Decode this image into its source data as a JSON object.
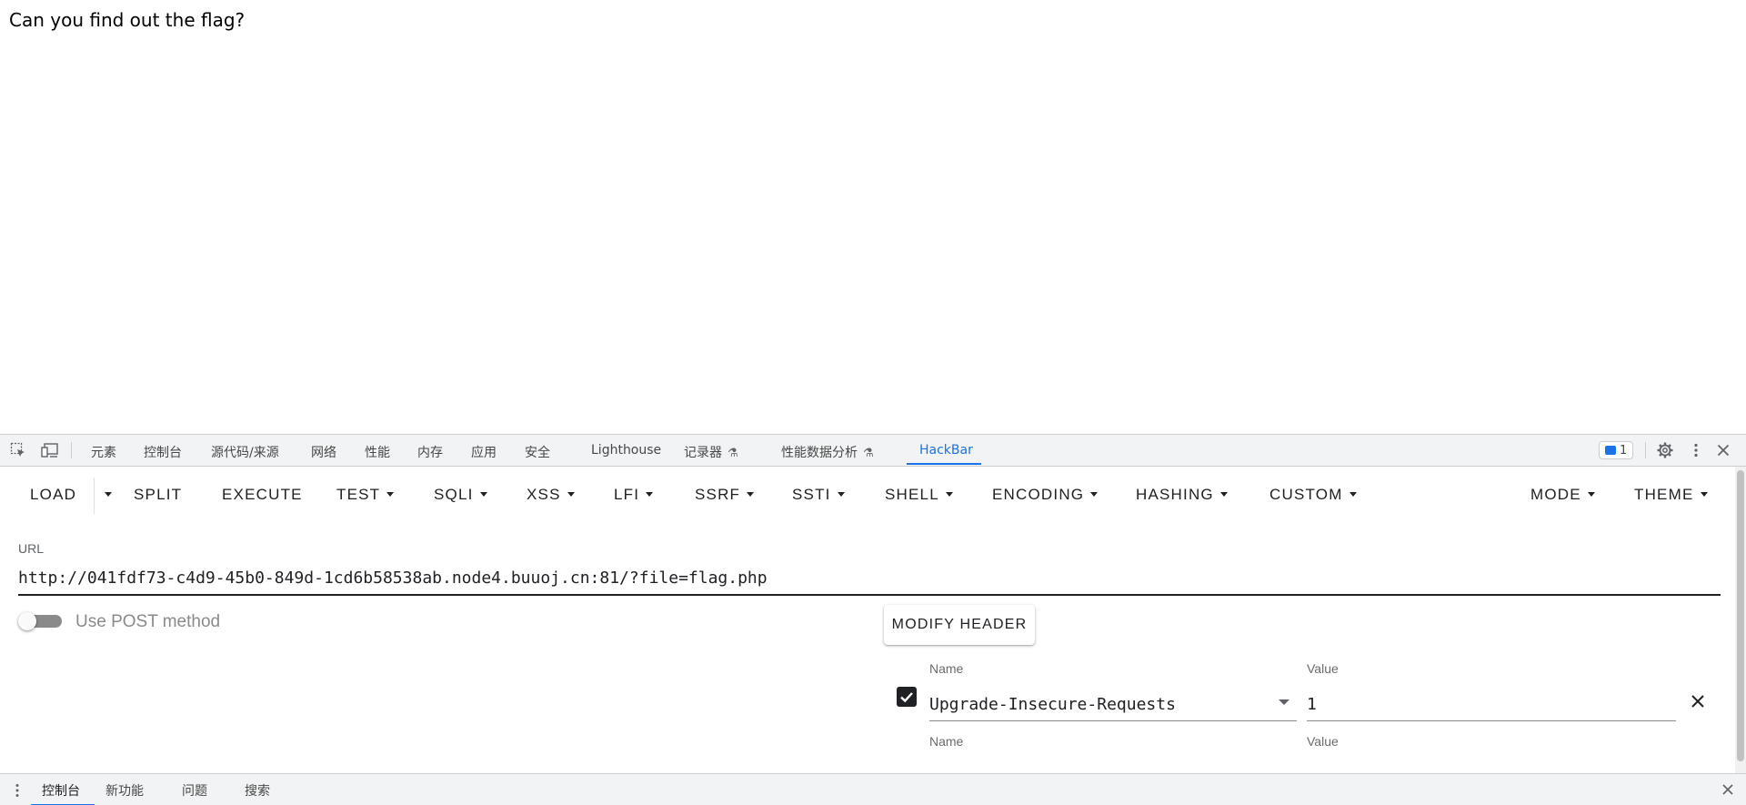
{
  "page": {
    "heading": "Can you find out the flag?"
  },
  "devtools": {
    "tabs": [
      "元素",
      "控制台",
      "源代码/来源",
      "网络",
      "性能",
      "内存",
      "应用",
      "安全",
      "Lighthouse",
      "记录器",
      "性能数据分析",
      "HackBar"
    ],
    "active_tab": "HackBar",
    "issues_count": "1",
    "accent_color": "#1a73e8"
  },
  "hackbar": {
    "menu": {
      "load": "LOAD",
      "split": "SPLIT",
      "execute": "EXECUTE",
      "test": "TEST",
      "sqli": "SQLI",
      "xss": "XSS",
      "lfi": "LFI",
      "ssrf": "SSRF",
      "ssti": "SSTI",
      "shell": "SHELL",
      "encoding": "ENCODING",
      "hashing": "HASHING",
      "custom": "CUSTOM",
      "mode": "MODE",
      "theme": "THEME"
    },
    "url_label": "URL",
    "url_value": "http://041fdf73-c4d9-45b0-849d-1cd6b58538ab.node4.buuoj.cn:81/?file=flag.php",
    "post_toggle_label": "Use POST method",
    "modify_header_label": "MODIFY HEADER",
    "headers": [
      {
        "name_label": "Name",
        "value_label": "Value",
        "name": "Upgrade-Insecure-Requests",
        "value": "1",
        "enabled": true
      },
      {
        "name_label": "Name",
        "value_label": "Value"
      }
    ]
  },
  "drawer": {
    "tabs": [
      "控制台",
      "新功能",
      "问题",
      "搜索"
    ],
    "active_tab": "控制台"
  }
}
